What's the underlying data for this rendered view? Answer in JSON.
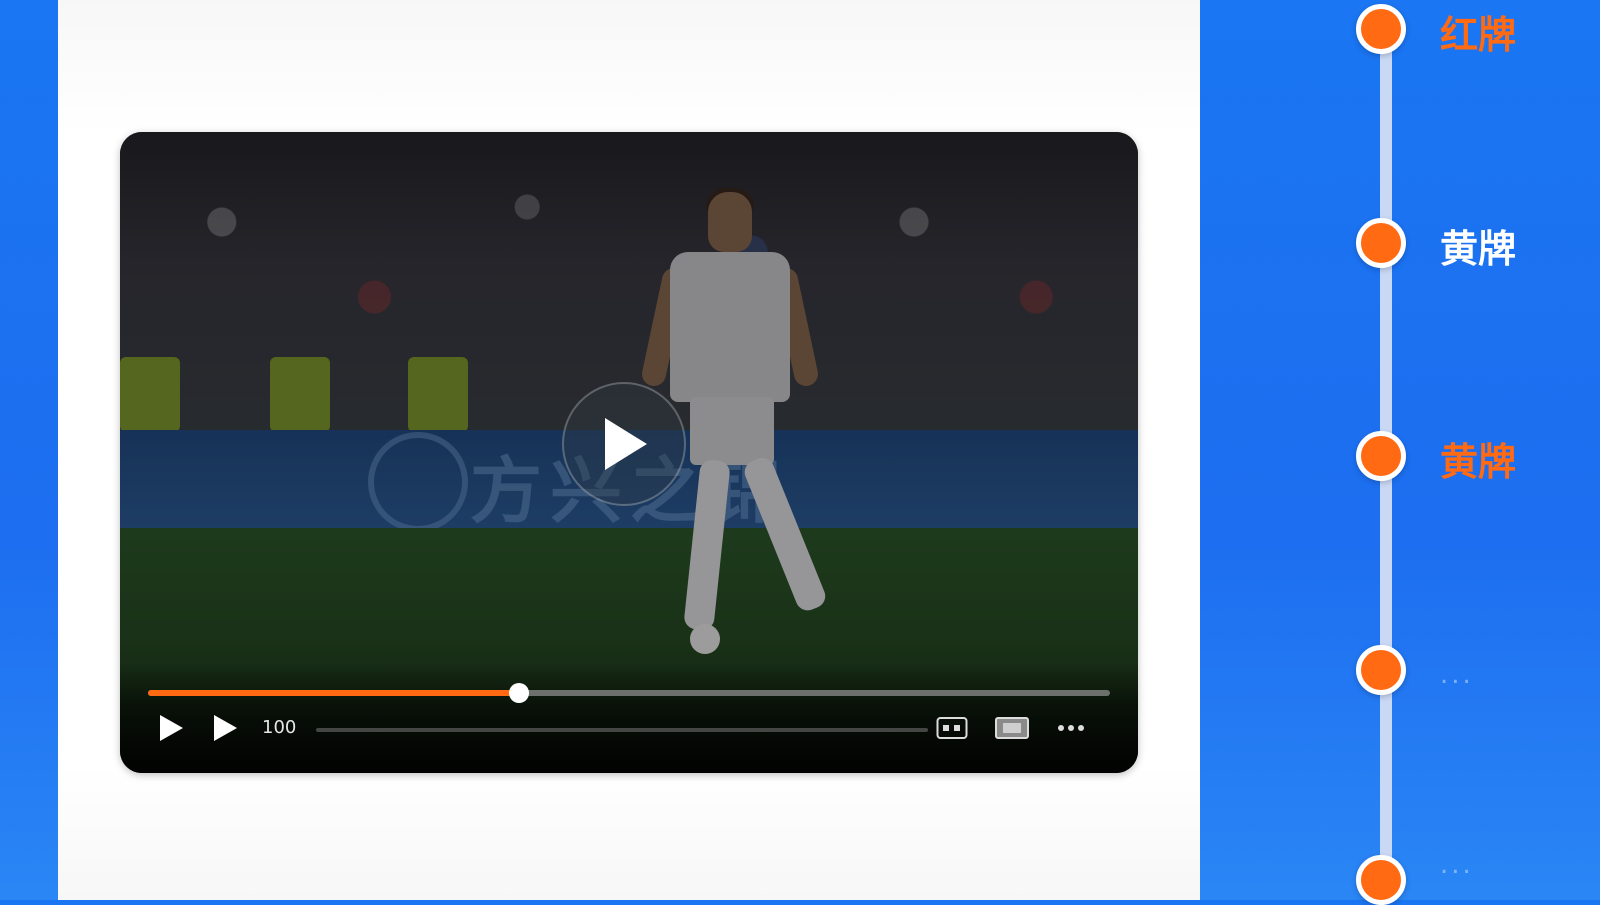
{
  "colors": {
    "page_background": "#1a76f2",
    "accent_orange": "#ff6a13",
    "timeline_line": "#c9d8f5",
    "label_white": "#ffffff"
  },
  "video": {
    "banner_text": "方兴之锦",
    "speed_label": "100",
    "progress_fraction": 0.386,
    "icons": {
      "center": "play-icon",
      "controls": [
        "play-icon",
        "next-icon",
        "subtitles-icon",
        "picture-in-picture-icon",
        "more-icon"
      ]
    }
  },
  "timeline": {
    "items": [
      {
        "label": "红牌",
        "color": "#ff6a13"
      },
      {
        "label": "黄牌",
        "color": "#ffffff"
      },
      {
        "label": "黄牌",
        "color": "#ff6a13"
      },
      {
        "label": "...",
        "color": "#ffffff"
      },
      {
        "label": "...",
        "color": "#ffffff"
      }
    ]
  }
}
